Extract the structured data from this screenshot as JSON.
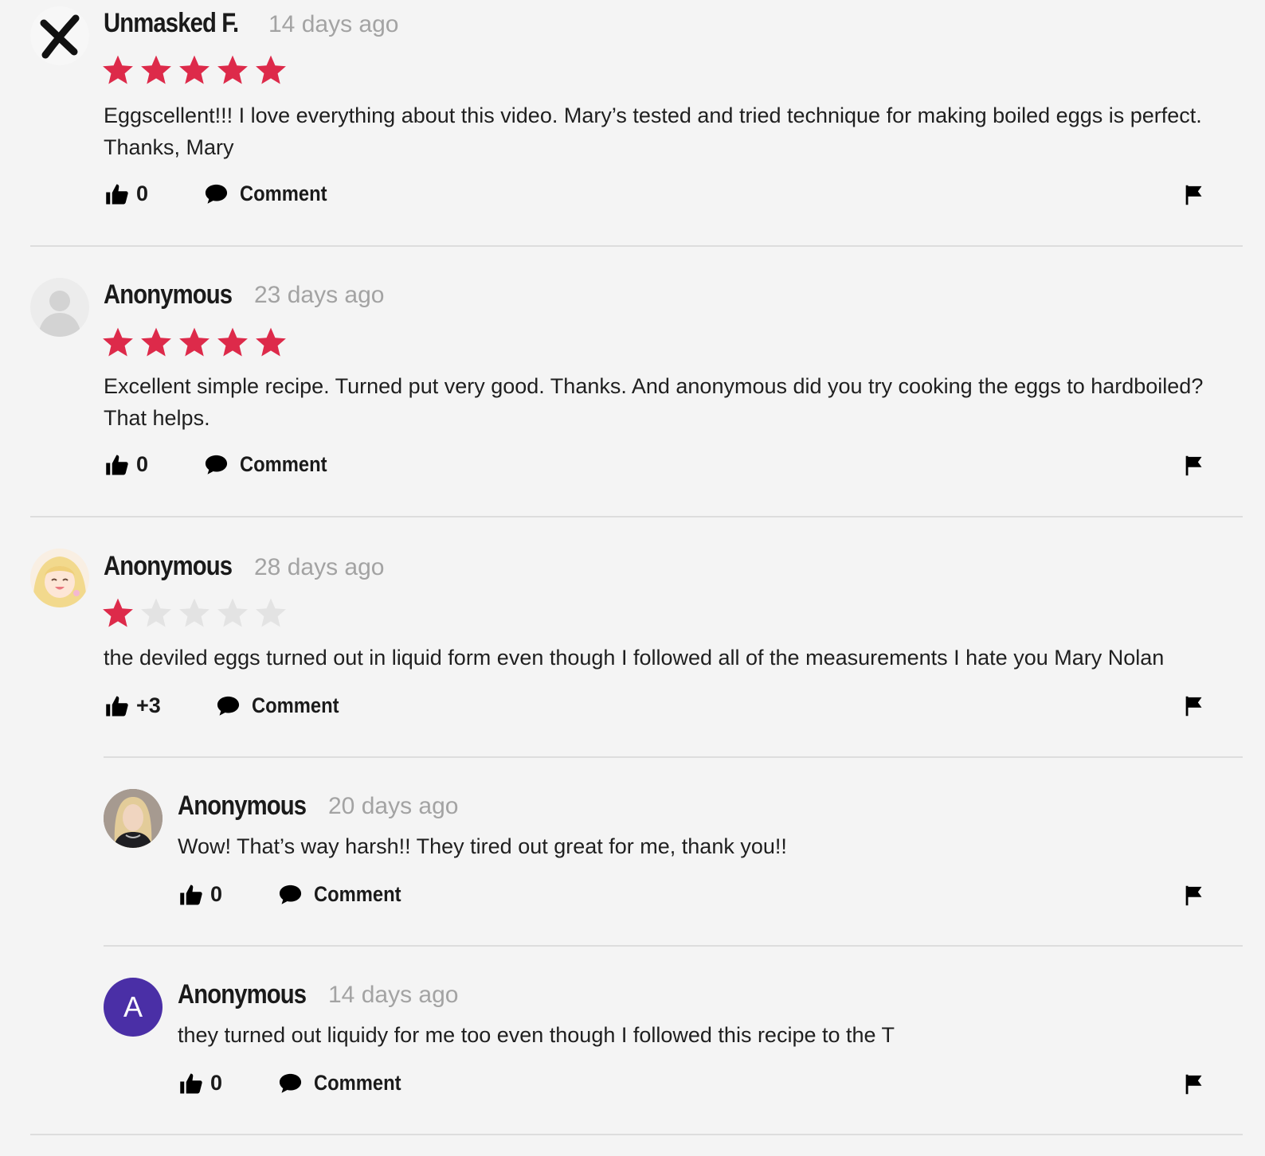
{
  "colors": {
    "star_filled": "#dd2a4a",
    "star_empty": "#e3e3e3",
    "divider": "#dddddd",
    "avatar_letter_bg": "#4a2fa6"
  },
  "comments": [
    {
      "author": "Unmasked F.",
      "time": "14 days ago",
      "rating": 5,
      "avatar": "x-mark-icon",
      "text": "Eggscellent!!!  I love everything about this video.  Mary’s tested and tried technique for making boiled eggs is perfect. Thanks, Mary",
      "likes": "0",
      "comment_label": "Comment"
    },
    {
      "author": "Anonymous",
      "time": "23 days ago",
      "rating": 5,
      "avatar": "default-user-icon",
      "text": "Excellent simple recipe. Turned put very good. Thanks. And anonymous did you try cooking the eggs to hardboiled? That helps.",
      "likes": "0",
      "comment_label": "Comment"
    },
    {
      "author": "Anonymous",
      "time": "28 days ago",
      "rating": 1,
      "avatar": "anime-girl-avatar",
      "text": "the deviled eggs turned out in liquid form even though I followed all of the measurements I hate you Mary Nolan",
      "likes": "+3",
      "comment_label": "Comment"
    }
  ],
  "replies": [
    {
      "author": "Anonymous",
      "time": "20 days ago",
      "avatar": "woman-photo-avatar",
      "text": "Wow! That’s way harsh!! They tired out great for me, thank you!!",
      "likes": "0",
      "comment_label": "Comment"
    },
    {
      "author": "Anonymous",
      "time": "14 days ago",
      "avatar": "letter-avatar",
      "avatar_letter": "A",
      "text": "they turned out liquidy for me too even though I followed this recipe to the T",
      "likes": "0",
      "comment_label": "Comment"
    }
  ]
}
